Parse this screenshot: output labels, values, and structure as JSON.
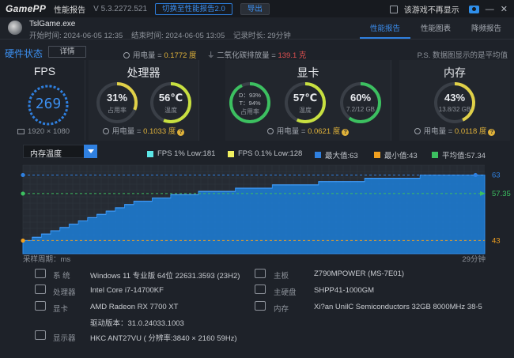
{
  "app": {
    "logo_text": "GamePP",
    "title": "性能报告",
    "version": "V 5.3.2272.521",
    "switch_button": "切换至性能报告2.0",
    "export_button": "导出",
    "hide_checkbox_label": "该游戏不再显示"
  },
  "game": {
    "name": "TslGame.exe",
    "start": "开始时间: 2024-06-05 12:35",
    "end": "结束时间: 2024-06-05 13:05",
    "duration": "记录时长: 29分钟"
  },
  "tabs": [
    {
      "label": "性能报告",
      "active": true
    },
    {
      "label": "性能图表",
      "active": false
    },
    {
      "label": "降频报告",
      "active": false
    }
  ],
  "hardware": {
    "title": "硬件状态",
    "detail_button": "详情",
    "power_label": "用电量 = ",
    "power_value": "0.1772 度",
    "co2_label": "二氧化碳排放量 = ",
    "co2_value": "139.1 克",
    "hint": "P.S. 数据图显示的是平均值"
  },
  "fps": {
    "title": "FPS",
    "value": "269",
    "resolution": "1920 × 1080"
  },
  "cpu": {
    "title": "处理器",
    "usage": "31%",
    "usage_label": "占用率",
    "usage_fraction": 0.31,
    "temp": "56℃",
    "temp_label": "温度",
    "temp_fraction": 0.56,
    "power_label": "用电量 = ",
    "power_value": "0.1033 度"
  },
  "gpu": {
    "title": "显卡",
    "d_value": "D：93%",
    "t_value": "T：94%",
    "usage_label": "占用率",
    "usage_fraction": 0.93,
    "temp": "57℃",
    "temp_label": "温度",
    "temp_fraction": 0.57,
    "vram": "60%",
    "vram_detail": "7.2/12 GB",
    "vram_fraction": 0.6,
    "power_label": "用电量 = ",
    "power_value": "0.0621 度"
  },
  "memory": {
    "title": "内存",
    "usage": "43%",
    "detail": "13.8/32 GB",
    "usage_fraction": 0.43,
    "power_label": "用电量 = ",
    "power_value": "0.0118 度"
  },
  "chart_controls": {
    "metric": "内存温度",
    "legend": [
      {
        "label": "FPS 1% Low:181",
        "color": "#5ce6e6"
      },
      {
        "label": "FPS 0.1% Low:128",
        "color": "#f0f060"
      },
      {
        "label": "最大值:63",
        "color": "#2f80e0"
      },
      {
        "label": "最小值:43",
        "color": "#f0a020"
      },
      {
        "label": "平均值:57.34",
        "color": "#3cc060"
      }
    ],
    "sample_label": "采样周期：ms",
    "duration_label": "29分钟"
  },
  "chart_data": {
    "type": "area",
    "title": "",
    "xlabel": "采样周期：ms",
    "ylabel": "",
    "x_range": [
      "0",
      "29分钟"
    ],
    "ylim": [
      43,
      63
    ],
    "markers": {
      "max": 63,
      "avg": 57.34,
      "min": 43
    },
    "marker_labels": {
      "max": "63",
      "avg": "57.35",
      "min": "43"
    },
    "values": [
      43,
      44,
      45,
      46,
      47,
      48,
      49,
      50,
      51,
      52,
      53,
      54,
      55,
      55,
      56,
      56,
      57,
      57,
      57,
      58,
      58,
      58,
      58,
      59,
      59,
      59,
      59,
      60,
      60,
      60,
      60,
      60,
      61,
      61,
      61,
      61,
      61,
      62,
      62,
      62,
      62,
      62,
      62,
      63,
      63,
      63,
      63,
      63,
      63,
      63
    ]
  },
  "system": {
    "os_label": "系 统",
    "os_value": "Windows 11 专业版 64位 22631.3593 (23H2)",
    "cpu_label": "处理器",
    "cpu_value": "Intel Core i7-14700KF",
    "gpu_label": "显卡",
    "gpu_value": "AMD Radeon RX 7700 XT",
    "driver_value": "驱动版本：31.0.24033.1003",
    "monitor_label": "显示器",
    "monitor_value": "HKC ANT27VU ( 分辨率:3840 × 2160 59Hz)",
    "board_label": "主板",
    "board_value": "Z790MPOWER (MS-7E01)",
    "disk_label": "主硬盘",
    "disk_value": "SHPP41-1000GM",
    "mem_label": "内存",
    "mem_value": "Xi?an UnilC Semiconductors 32GB 8000MHz 38-5"
  }
}
